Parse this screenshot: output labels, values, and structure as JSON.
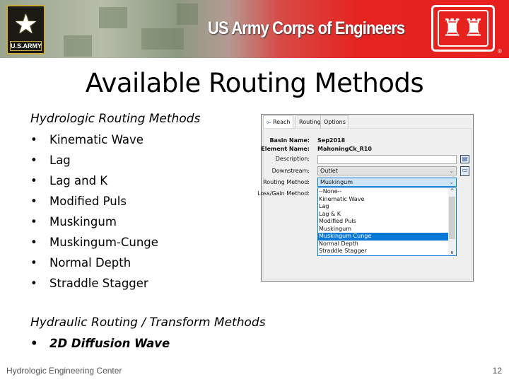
{
  "banner": {
    "title": "US Army Corps of Engineers",
    "army_logo_text": "U.S.ARMY",
    "registered": "®"
  },
  "slide": {
    "title": "Available Routing Methods",
    "hydrologic_heading": "Hydrologic Routing Methods",
    "hydrologic_items": [
      "Kinematic Wave",
      "Lag",
      "Lag and K",
      "Modified Puls",
      "Muskingum",
      "Muskingum-Cunge",
      "Normal Depth",
      "Straddle Stagger"
    ],
    "hydraulic_heading": "Hydraulic Routing / Transform Methods",
    "hydraulic_items": [
      "2D Diffusion Wave"
    ]
  },
  "footer": {
    "org": "Hydrologic Engineering Center",
    "page": "12"
  },
  "dialog": {
    "tabs": [
      "Reach",
      "Routing",
      "Options"
    ],
    "basin_label": "Basin Name:",
    "basin_value": "Sep2018",
    "element_label": "Element Name:",
    "element_value": "MahoningCk_R10",
    "description_label": "Description:",
    "description_value": "",
    "downstream_label": "Downstream:",
    "downstream_value": "Outlet",
    "routing_label": "Routing Method:",
    "routing_value": "Muskingum",
    "lossgain_label": "Loss/Gain Method:",
    "options": [
      "--None--",
      "Kinematic Wave",
      "Lag",
      "Lag & K",
      "Modified Puls",
      "Muskingum",
      "Muskingum Cunge",
      "Normal Depth",
      "Straddle Stagger"
    ],
    "highlighted": "Muskingum Cunge"
  },
  "colors": {
    "accent": "#0a78d7",
    "banner_red": "#e52421"
  }
}
